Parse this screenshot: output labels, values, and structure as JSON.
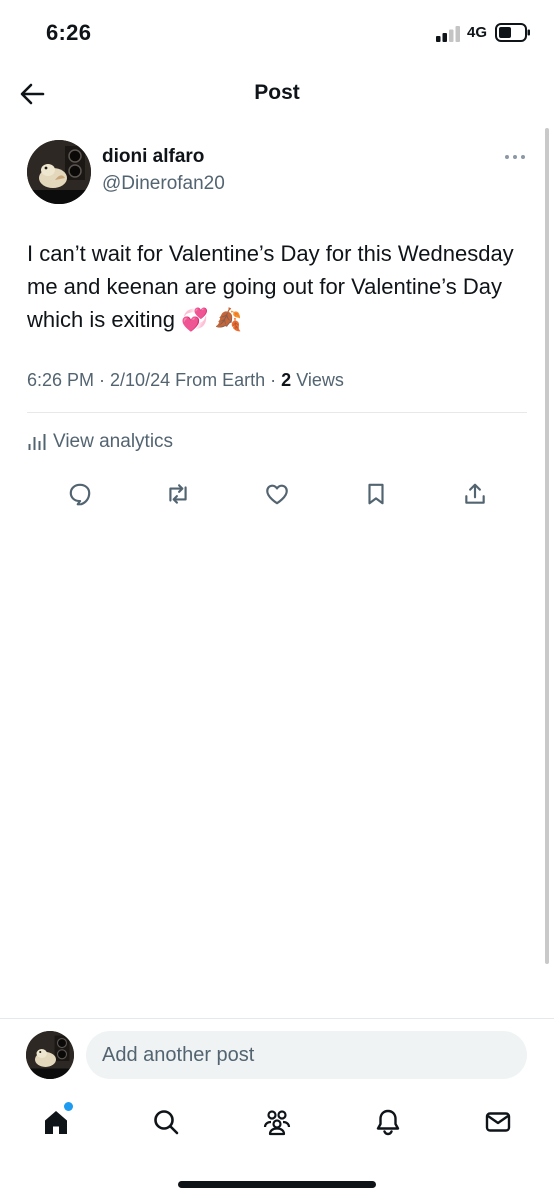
{
  "status_bar": {
    "time": "6:26",
    "network": "4G"
  },
  "header": {
    "title": "Post"
  },
  "post": {
    "author_name": "dioni alfaro",
    "author_handle": "@Dinerofan20",
    "text": "I can’t wait for Valentine’s Day for this Wednesday me and keenan are going out for Valentine’s Day which is exiting 💞 🍂",
    "timestamp": "6:26 PM · 2/10/24",
    "source": "From Earth",
    "separator": "·",
    "views_count": "2",
    "views_label": "Views",
    "analytics_label": "View analytics"
  },
  "actions": [
    "reply",
    "repost",
    "like",
    "bookmark",
    "share"
  ],
  "compose": {
    "placeholder": "Add another post"
  },
  "tab_bar": {
    "items": [
      "home",
      "search",
      "communities",
      "notifications",
      "messages"
    ],
    "home_has_notification_dot": true
  },
  "colors": {
    "text": "#0f1419",
    "secondary": "#536471",
    "accent": "#1d9bf0",
    "divider": "#e6e9eb",
    "input_bg": "#eff3f4"
  }
}
